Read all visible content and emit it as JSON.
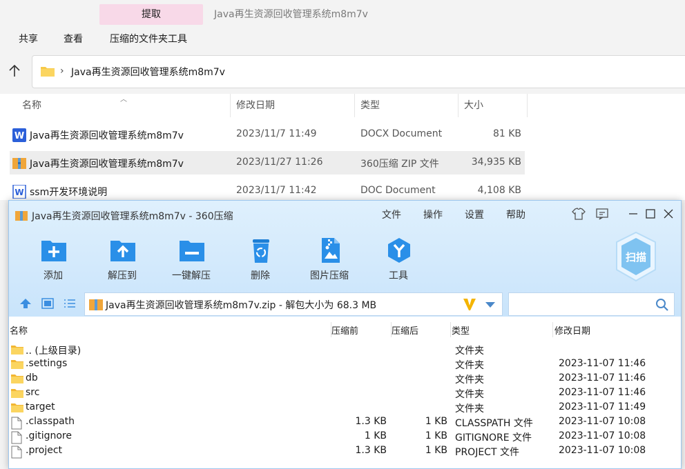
{
  "explorer": {
    "tool_tab": "提取",
    "window_title": "Java再生资源回收管理系统m8m7v",
    "menu": [
      "共享",
      "查看",
      "压缩的文件夹工具"
    ],
    "address": "Java再生资源回收管理系统m8m7v",
    "columns": [
      "名称",
      "修改日期",
      "类型",
      "大小"
    ],
    "files": [
      {
        "name": "Java再生资源回收管理系统m8m7v",
        "date": "2023/11/7 11:49",
        "type": "DOCX Document",
        "size": "81 KB",
        "icon": "word-docx-icon"
      },
      {
        "name": "Java再生资源回收管理系统m8m7v",
        "date": "2023/11/27 11:26",
        "type": "360压缩 ZIP 文件",
        "size": "34,935 KB",
        "icon": "zip-archive-icon"
      },
      {
        "name": "ssm开发环境说明",
        "date": "2023/11/7 11:42",
        "type": "DOC Document",
        "size": "4,108 KB",
        "icon": "word-doc-icon"
      }
    ]
  },
  "zip": {
    "title": "Java再生资源回收管理系统m8m7v - 360压缩",
    "menu": [
      "文件",
      "操作",
      "设置",
      "帮助"
    ],
    "tools": [
      "添加",
      "解压到",
      "一键解压",
      "删除",
      "图片压缩",
      "工具"
    ],
    "scan_label": "扫描",
    "address": "Java再生资源回收管理系统m8m7v.zip - 解包大小为 68.3 MB",
    "columns": [
      "名称",
      "压缩前",
      "压缩后",
      "类型",
      "修改日期"
    ],
    "rows": [
      {
        "name": ".. (上级目录)",
        "before": "",
        "after": "",
        "type": "文件夹",
        "date": "",
        "kind": "folder"
      },
      {
        "name": ".settings",
        "before": "",
        "after": "",
        "type": "文件夹",
        "date": "2023-11-07 11:46",
        "kind": "folder"
      },
      {
        "name": "db",
        "before": "",
        "after": "",
        "type": "文件夹",
        "date": "2023-11-07 11:46",
        "kind": "folder"
      },
      {
        "name": "src",
        "before": "",
        "after": "",
        "type": "文件夹",
        "date": "2023-11-07 11:46",
        "kind": "folder"
      },
      {
        "name": "target",
        "before": "",
        "after": "",
        "type": "文件夹",
        "date": "2023-11-07 11:49",
        "kind": "folder"
      },
      {
        "name": ".classpath",
        "before": "1.3 KB",
        "after": "1 KB",
        "type": "CLASSPATH 文件",
        "date": "2023-11-07 10:08",
        "kind": "file"
      },
      {
        "name": ".gitignore",
        "before": "1 KB",
        "after": "1 KB",
        "type": "GITIGNORE 文件",
        "date": "2023-11-07 10:08",
        "kind": "file"
      },
      {
        "name": ".project",
        "before": "1.3 KB",
        "after": "1 KB",
        "type": "PROJECT 文件",
        "date": "2023-11-07 10:08",
        "kind": "file"
      }
    ]
  },
  "colors": {
    "accent": "#1e88e5",
    "tool_tab_bg": "#f8d9e8",
    "zip_header_bg": "#cfe6fb",
    "selected_row": "#ededed"
  }
}
